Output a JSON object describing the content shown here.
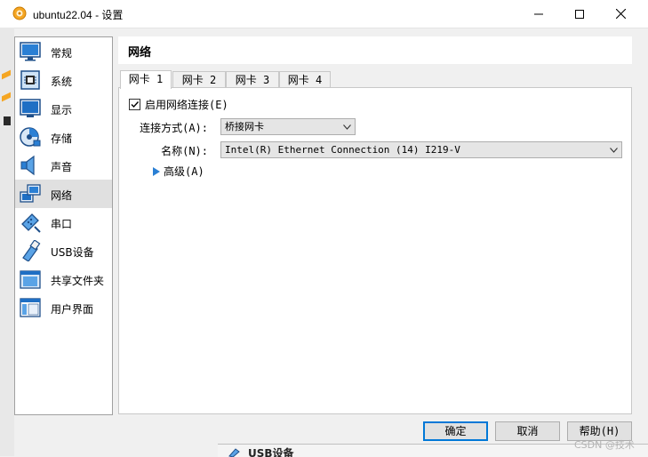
{
  "window": {
    "title": "ubuntu22.04 - 设置",
    "controls": [
      "minimize-icon",
      "maximize-icon",
      "close-icon"
    ]
  },
  "sidebar": {
    "items": [
      {
        "label": "常规",
        "icon": "general-icon"
      },
      {
        "label": "系统",
        "icon": "system-chip-icon"
      },
      {
        "label": "显示",
        "icon": "display-monitor-icon"
      },
      {
        "label": "存储",
        "icon": "storage-disk-icon"
      },
      {
        "label": "声音",
        "icon": "speaker-icon"
      },
      {
        "label": "网络",
        "icon": "network-icon",
        "selected": true
      },
      {
        "label": "串口",
        "icon": "serial-port-icon"
      },
      {
        "label": "USB设备",
        "icon": "usb-icon"
      },
      {
        "label": "共享文件夹",
        "icon": "shared-folder-icon"
      },
      {
        "label": "用户界面",
        "icon": "user-interface-icon"
      }
    ]
  },
  "panel": {
    "title": "网络",
    "tabs": [
      {
        "label": "网卡 1",
        "active": true
      },
      {
        "label": "网卡 2"
      },
      {
        "label": "网卡 3"
      },
      {
        "label": "网卡 4"
      }
    ],
    "enable_label": "启用网络连接(E)",
    "enable_checked": true,
    "attached_label": "连接方式(A):",
    "attached_value": "桥接网卡",
    "name_label": "名称(N):",
    "name_value": "Intel(R) Ethernet Connection (14) I219-V",
    "advanced_label": "高级(A)"
  },
  "buttons": {
    "ok": "确定",
    "cancel": "取消",
    "help": "帮助(H)"
  },
  "background": {
    "usb_text": "USB设备"
  },
  "watermark": "CSDN @技术",
  "colors": {
    "accent": "#0078d7",
    "selected_bg": "#e0e0e0",
    "icon_blue": "#2a7fd4"
  }
}
